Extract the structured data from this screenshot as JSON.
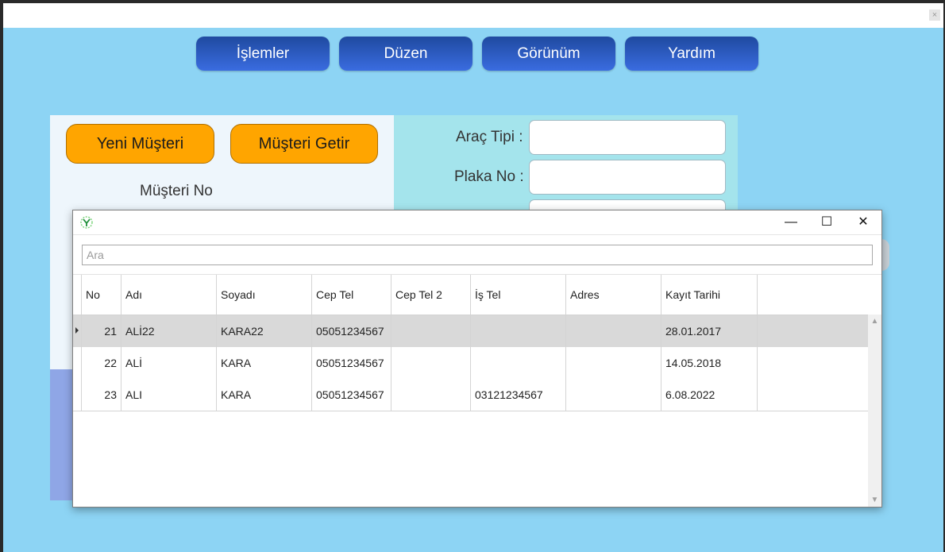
{
  "menu": {
    "items": [
      "İşlemler",
      "Düzen",
      "Görünüm",
      "Yardım"
    ]
  },
  "window": {
    "close_glyph": "×"
  },
  "form": {
    "new_customer_label": "Yeni Müşteri",
    "get_customer_label": "Müşteri Getir",
    "customer_no_label": "Müşteri No",
    "vehicle_type_label": "Araç Tipi :",
    "plate_no_label": "Plaka No :",
    "vehicle_type_value": "",
    "plate_no_value": ""
  },
  "dialog": {
    "minimize_glyph": "—",
    "maximize_glyph": "☐",
    "close_glyph": "✕",
    "search_placeholder": "Ara",
    "columns": [
      "No",
      "Adı",
      "Soyadı",
      "Cep Tel",
      "Cep Tel 2",
      "İş Tel",
      "Adres",
      "Kayıt Tarihi"
    ],
    "rows": [
      [
        "21",
        "ALİ22",
        "KARA22",
        "05051234567",
        "",
        "",
        "",
        "28.01.2017"
      ],
      [
        "22",
        "ALİ",
        "KARA",
        "05051234567",
        "",
        "",
        "",
        "14.05.2018"
      ],
      [
        "23",
        "ALI",
        "KARA",
        "05051234567",
        "",
        "03121234567",
        "",
        "6.08.2022"
      ]
    ],
    "selected_row": 0,
    "scroll_up_glyph": "▲",
    "scroll_down_glyph": "▼"
  },
  "colors": {
    "background": "#8dd4f4",
    "menu_button": "#2a5bc4",
    "orange_button": "#ffa500",
    "selected_row": "#d9d9d9"
  },
  "icons": {
    "app": "app-logo-icon"
  }
}
